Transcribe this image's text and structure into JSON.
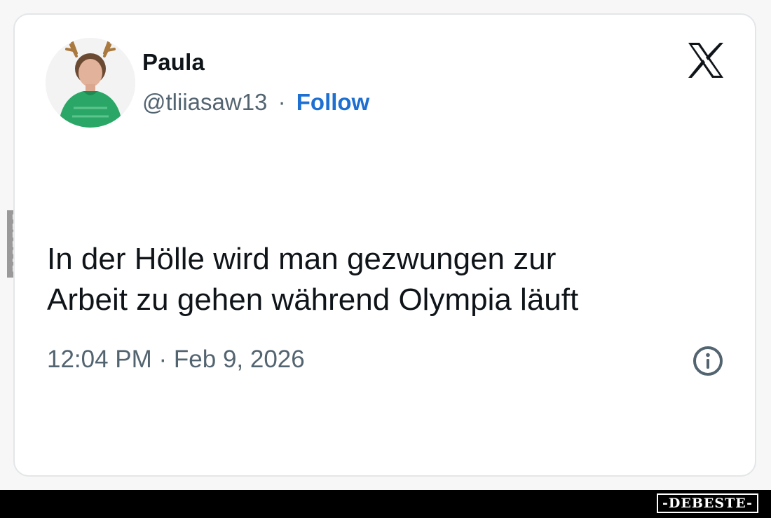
{
  "tweet": {
    "author": {
      "display_name": "Paula",
      "handle": "@tliiasaw13",
      "separator": "·",
      "follow_label": "Follow"
    },
    "text_lines": [
      "In der Hölle wird man gezwungen zur",
      "Arbeit zu gehen während Olympia läuft"
    ],
    "timestamp": "12:04 PM · Feb 9, 2026",
    "platform_icon": "x-logo-icon",
    "info_icon": "info-icon"
  },
  "watermark": {
    "side_text": "DEBESTE",
    "brand_text": "-DEBESTE-"
  },
  "colors": {
    "text_primary": "#0f1419",
    "text_secondary": "#536471",
    "follow_blue": "#1d6fd1",
    "card_border": "#e3e6e8"
  }
}
